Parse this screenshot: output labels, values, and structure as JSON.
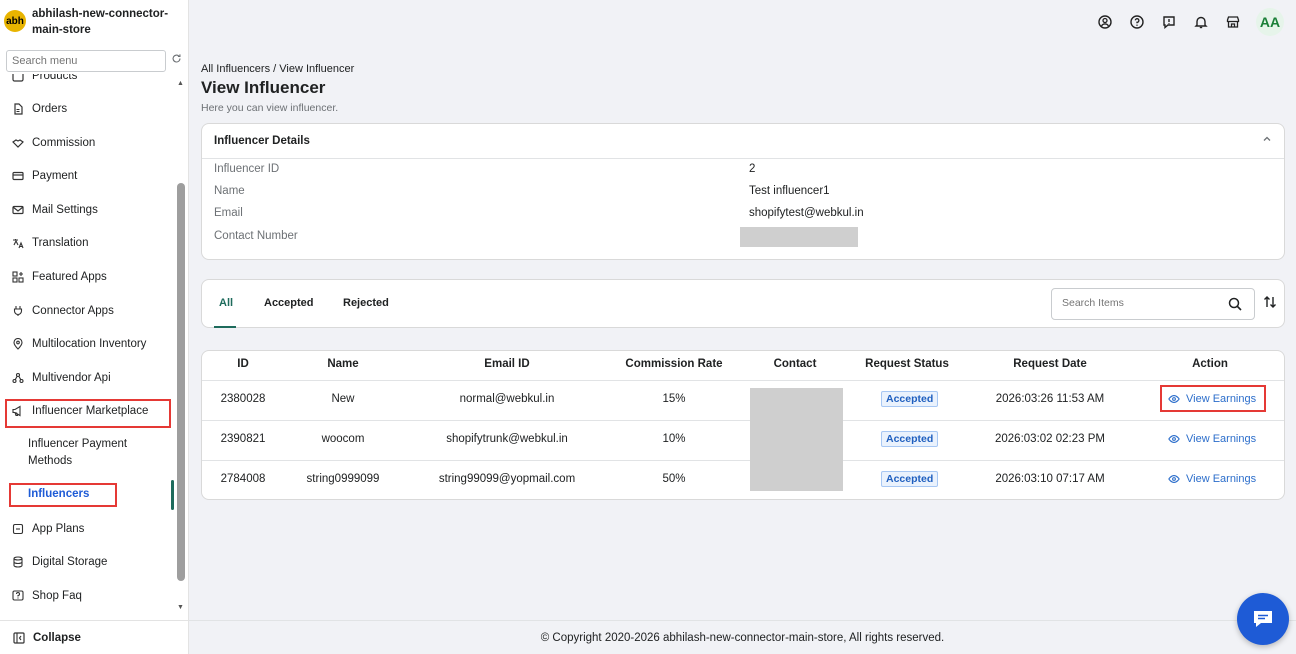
{
  "store": {
    "logo_text": "abh",
    "name": "abhilash-new-connector-main-store"
  },
  "sidebar": {
    "search_placeholder": "Search menu",
    "partial_item": "Products",
    "items": [
      {
        "label": "Orders",
        "icon": "document-icon"
      },
      {
        "label": "Commission",
        "icon": "handshake-icon"
      },
      {
        "label": "Payment",
        "icon": "card-icon"
      },
      {
        "label": "Mail Settings",
        "icon": "mail-icon"
      },
      {
        "label": "Translation",
        "icon": "translate-icon"
      },
      {
        "label": "Featured Apps",
        "icon": "apps-icon"
      },
      {
        "label": "Connector Apps",
        "icon": "plug-icon"
      },
      {
        "label": "Multilocation Inventory",
        "icon": "location-icon"
      },
      {
        "label": "Multivendor Api",
        "icon": "network-icon"
      },
      {
        "label": "Influencer Marketplace",
        "icon": "megaphone-icon"
      }
    ],
    "sub_items": [
      {
        "label": "Influencer Payment Methods"
      },
      {
        "label": "Influencers"
      }
    ],
    "items_after": [
      {
        "label": "App Plans",
        "icon": "plans-icon"
      },
      {
        "label": "Digital Storage",
        "icon": "database-icon"
      },
      {
        "label": "Shop Faq",
        "icon": "faq-icon"
      }
    ],
    "collapse_label": "Collapse"
  },
  "header": {
    "avatar_initials": "AA"
  },
  "page": {
    "breadcrumb": "All Influencers / View Influencer",
    "title": "View Influencer",
    "subtitle": "Here you can view influencer."
  },
  "details": {
    "title": "Influencer Details",
    "fields": [
      {
        "label": "Influencer ID",
        "value": "2"
      },
      {
        "label": "Name",
        "value": "Test influencer1"
      },
      {
        "label": "Email",
        "value": "shopifytest@webkul.in"
      },
      {
        "label": "Contact Number",
        "value": ""
      }
    ]
  },
  "tabs": [
    {
      "label": "All"
    },
    {
      "label": "Accepted"
    },
    {
      "label": "Rejected"
    }
  ],
  "search_items_placeholder": "Search Items",
  "table": {
    "headers": [
      "ID",
      "Name",
      "Email ID",
      "Commission Rate",
      "Contact",
      "Request Status",
      "Request Date",
      "Action"
    ],
    "rows": [
      {
        "id": "2380028",
        "name": "New",
        "email": "normal@webkul.in",
        "rate": "15%",
        "status": "Accepted",
        "date": "2026:03:26 11:53 AM",
        "action": "View Earnings"
      },
      {
        "id": "2390821",
        "name": "woocom",
        "email": "shopifytrunk@webkul.in",
        "rate": "10%",
        "status": "Accepted",
        "date": "2026:03:02 02:23 PM",
        "action": "View Earnings"
      },
      {
        "id": "2784008",
        "name": "string0999099",
        "email": "string99099@yopmail.com",
        "rate": "50%",
        "status": "Accepted",
        "date": "2026:03:10 07:17 AM",
        "action": "View Earnings"
      }
    ]
  },
  "footer": {
    "text": "© Copyright 2020-2026 abhilash-new-connector-main-store, All rights reserved."
  }
}
